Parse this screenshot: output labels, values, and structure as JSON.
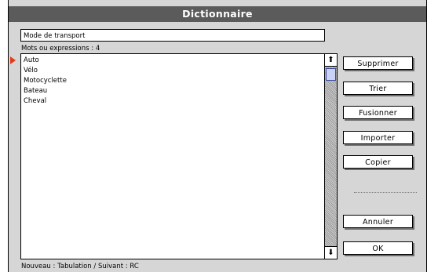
{
  "window": {
    "title": "Dictionnaire"
  },
  "entry": {
    "value": "Mode de transport"
  },
  "list": {
    "count_label": "Mots ou expressions : 4",
    "items": [
      "Auto",
      "Vélo",
      "Motocyclette",
      "Bateau",
      "Cheval"
    ]
  },
  "buttons": {
    "delete": "Supprimer",
    "sort": "Trier",
    "merge": "Fusionner",
    "import": "Importer",
    "copy": "Copier",
    "cancel": "Annuler",
    "ok": "OK"
  },
  "footer": {
    "hint": "Nouveau : Tabulation / Suivant : RC"
  },
  "icons": {
    "marker": "triangle-right-icon",
    "scroll_up": "arrow-up-icon",
    "scroll_down": "arrow-down-icon"
  },
  "colors": {
    "marker": "#e23a1a",
    "titlebar": "#5b5b5b",
    "scroll_thumb": "#c9d2f2"
  }
}
